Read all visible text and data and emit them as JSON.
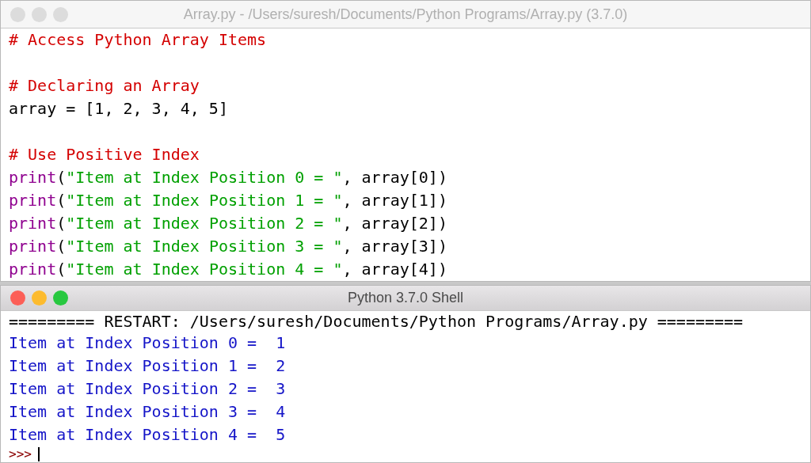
{
  "editor": {
    "title": "Array.py - /Users/suresh/Documents/Python Programs/Array.py (3.7.0)",
    "active": false,
    "lines": [
      {
        "kind": "code",
        "tokens": [
          {
            "kind": "comment",
            "text": "# Access Python Array Items"
          }
        ]
      },
      {
        "kind": "blank"
      },
      {
        "kind": "code",
        "tokens": [
          {
            "kind": "comment",
            "text": "# Declaring an Array"
          }
        ]
      },
      {
        "kind": "code",
        "tokens": [
          {
            "kind": "plain",
            "text": "array = [1, 2, 3, 4, 5]"
          }
        ]
      },
      {
        "kind": "blank"
      },
      {
        "kind": "code",
        "tokens": [
          {
            "kind": "comment",
            "text": "# Use Positive Index"
          }
        ]
      },
      {
        "kind": "code",
        "tokens": [
          {
            "kind": "builtin",
            "text": "print"
          },
          {
            "kind": "plain",
            "text": "("
          },
          {
            "kind": "string",
            "text": "\"Item at Index Position 0 = \""
          },
          {
            "kind": "plain",
            "text": ", array[0])"
          }
        ]
      },
      {
        "kind": "code",
        "tokens": [
          {
            "kind": "builtin",
            "text": "print"
          },
          {
            "kind": "plain",
            "text": "("
          },
          {
            "kind": "string",
            "text": "\"Item at Index Position 1 = \""
          },
          {
            "kind": "plain",
            "text": ", array[1])"
          }
        ]
      },
      {
        "kind": "code",
        "tokens": [
          {
            "kind": "builtin",
            "text": "print"
          },
          {
            "kind": "plain",
            "text": "("
          },
          {
            "kind": "string",
            "text": "\"Item at Index Position 2 = \""
          },
          {
            "kind": "plain",
            "text": ", array[2])"
          }
        ]
      },
      {
        "kind": "code",
        "tokens": [
          {
            "kind": "builtin",
            "text": "print"
          },
          {
            "kind": "plain",
            "text": "("
          },
          {
            "kind": "string",
            "text": "\"Item at Index Position 3 = \""
          },
          {
            "kind": "plain",
            "text": ", array[3])"
          }
        ]
      },
      {
        "kind": "code",
        "tokens": [
          {
            "kind": "builtin",
            "text": "print"
          },
          {
            "kind": "plain",
            "text": "("
          },
          {
            "kind": "string",
            "text": "\"Item at Index Position 4 = \""
          },
          {
            "kind": "plain",
            "text": ", array[4])"
          }
        ]
      }
    ]
  },
  "shell": {
    "title": "Python 3.7.0 Shell",
    "active": true,
    "restart": "========= RESTART: /Users/suresh/Documents/Python Programs/Array.py =========",
    "output": [
      "Item at Index Position 0 =  1",
      "Item at Index Position 1 =  2",
      "Item at Index Position 2 =  3",
      "Item at Index Position 3 =  4",
      "Item at Index Position 4 =  5"
    ],
    "prompt": ">>>"
  }
}
